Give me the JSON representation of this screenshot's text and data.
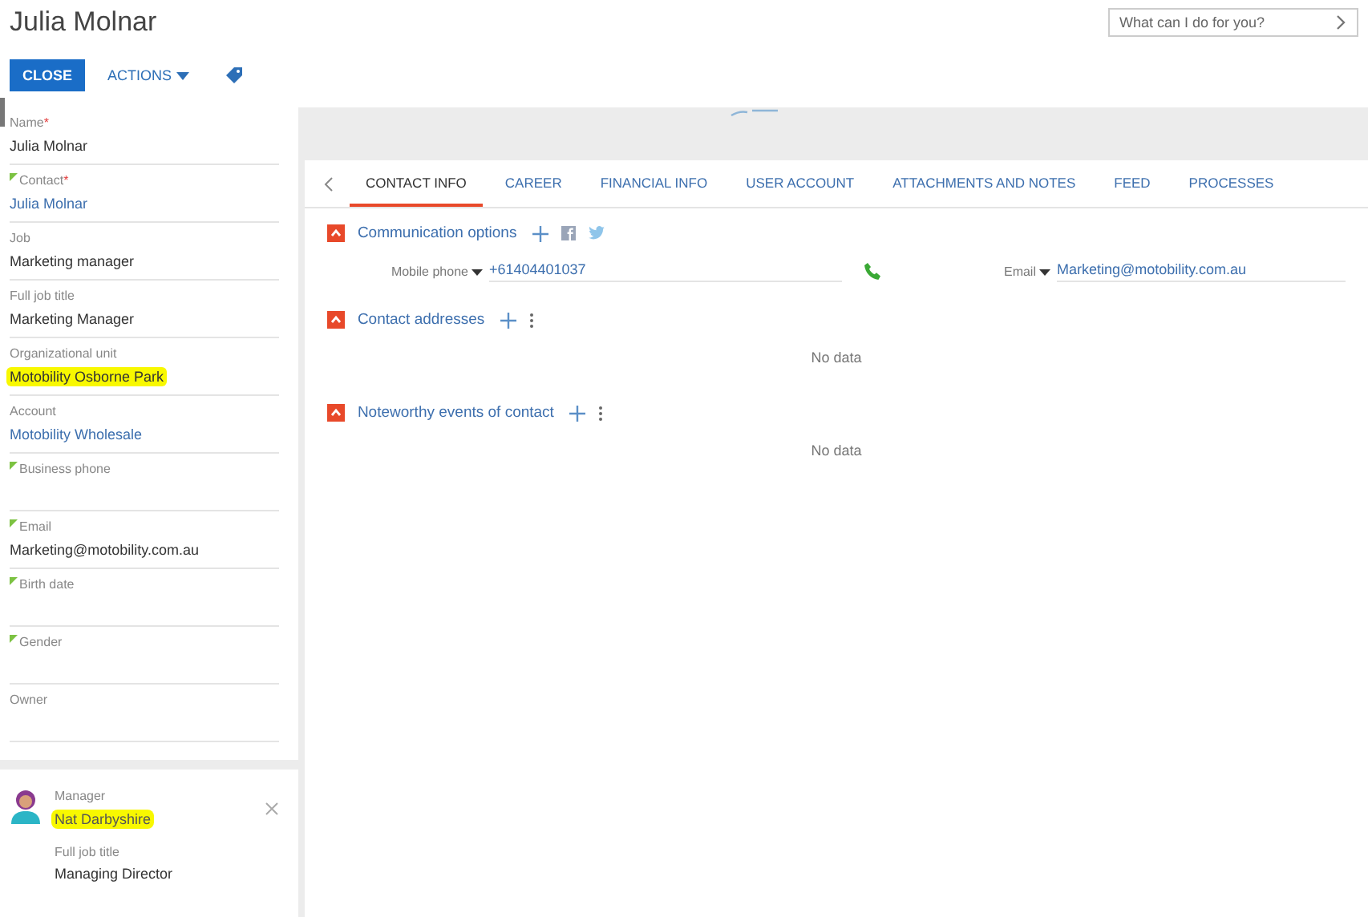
{
  "title": "Julia Molnar",
  "search": {
    "placeholder": "What can I do for you?"
  },
  "toolbar": {
    "close": "CLOSE",
    "actions": "ACTIONS"
  },
  "fields": [
    {
      "label": "Name",
      "required_mark": "*",
      "marked": false,
      "value": "Julia Molnar",
      "kind": "text",
      "highlighted": false
    },
    {
      "label": "Contact",
      "required_mark": "*",
      "marked": true,
      "value": "Julia Molnar",
      "kind": "lookup",
      "highlighted": false
    },
    {
      "label": "Job",
      "marked": false,
      "value": "Marketing manager",
      "kind": "text",
      "highlighted": false
    },
    {
      "label": "Full job title",
      "marked": false,
      "value": "Marketing Manager",
      "kind": "text",
      "highlighted": false
    },
    {
      "label": "Organizational unit",
      "marked": false,
      "value": "Motobility Osborne Park",
      "kind": "text",
      "highlighted": true
    },
    {
      "label": "Account",
      "marked": false,
      "value": "Motobility Wholesale",
      "kind": "lookup",
      "highlighted": false
    },
    {
      "label": "Business phone",
      "marked": true
    },
    {
      "label": "Email",
      "marked": true,
      "value": "Marketing@motobility.com.au",
      "kind": "text",
      "highlighted": false
    },
    {
      "label": "Birth date",
      "marked": true
    },
    {
      "label": "Gender",
      "marked": true
    },
    {
      "label": "Owner",
      "marked": false
    }
  ],
  "manager": {
    "label": "Manager",
    "name": "Nat Darbyshire",
    "highlighted": true,
    "job_label": "Full job title",
    "job": "Managing Director"
  },
  "tabs": [
    {
      "label": "CONTACT INFO",
      "selected": true
    },
    {
      "label": "CAREER",
      "selected": false
    },
    {
      "label": "FINANCIAL INFO",
      "selected": false
    },
    {
      "label": "USER ACCOUNT",
      "selected": false
    },
    {
      "label": "ATTACHMENTS AND NOTES",
      "selected": false
    },
    {
      "label": "FEED",
      "selected": false
    },
    {
      "label": "PROCESSES",
      "selected": false
    }
  ],
  "sections": [
    {
      "title": "Communication options",
      "kind": "communication",
      "expanded": true,
      "phone_label": "Mobile phone",
      "phone": "+61404401037",
      "email_label": "Email",
      "email": "Marketing@motobility.com.au"
    },
    {
      "title": "Contact addresses",
      "kind": "list",
      "expanded": true,
      "empty": "No data"
    },
    {
      "title": "Noteworthy events of contact",
      "kind": "list",
      "expanded": true,
      "empty": "No data"
    }
  ]
}
